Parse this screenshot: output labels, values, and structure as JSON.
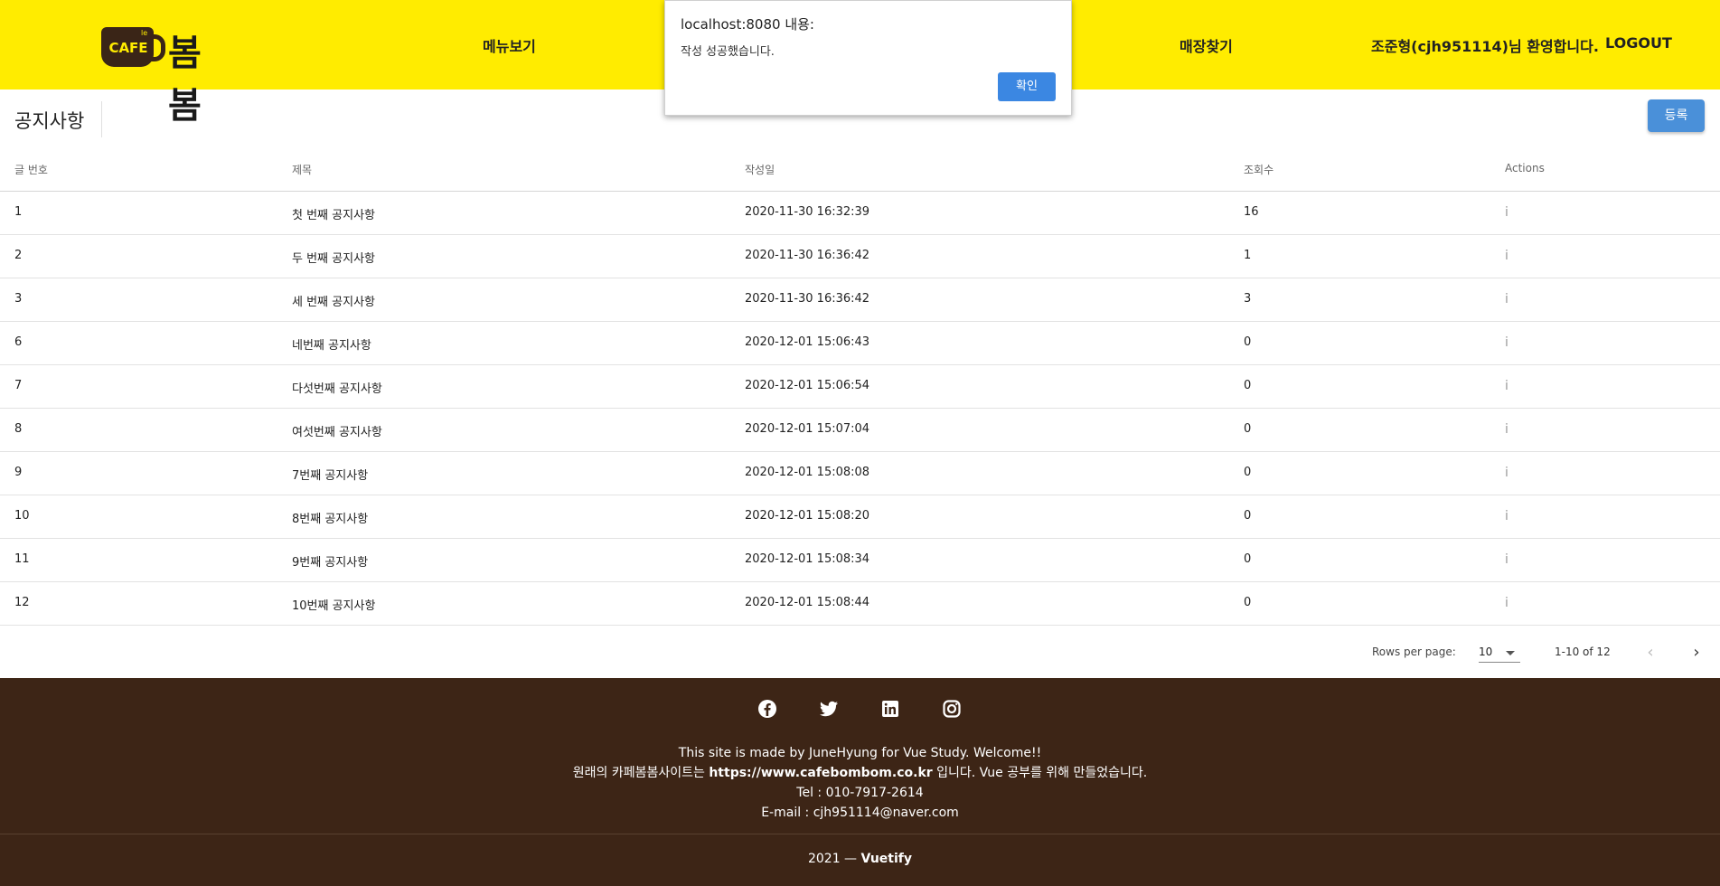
{
  "header": {
    "logo_cup_text": "CAFE",
    "logo_cup_small": "le",
    "logo_brand": "봄봄",
    "nav": {
      "menu": "메뉴보기",
      "store": "매장찾기"
    },
    "welcome": "조준형(cjh951114)님 환영합니다.",
    "logout": "LOGOUT"
  },
  "page": {
    "title": "공지사항",
    "register_label": "등록"
  },
  "table": {
    "headers": [
      "글 번호",
      "제목",
      "작성일",
      "조회수",
      "Actions"
    ],
    "rows": [
      {
        "no": "1",
        "title": "첫 번째 공지사항",
        "date": "2020-11-30 16:32:39",
        "views": "16"
      },
      {
        "no": "2",
        "title": "두 번째 공지사항",
        "date": "2020-11-30 16:36:42",
        "views": "1"
      },
      {
        "no": "3",
        "title": "세 번째 공지사항",
        "date": "2020-11-30 16:36:42",
        "views": "3"
      },
      {
        "no": "6",
        "title": "네번째 공지사항",
        "date": "2020-12-01 15:06:43",
        "views": "0"
      },
      {
        "no": "7",
        "title": "다섯번째 공지사항",
        "date": "2020-12-01 15:06:54",
        "views": "0"
      },
      {
        "no": "8",
        "title": "여섯번째 공지사항",
        "date": "2020-12-01 15:07:04",
        "views": "0"
      },
      {
        "no": "9",
        "title": "7번째 공지사항",
        "date": "2020-12-01 15:08:08",
        "views": "0"
      },
      {
        "no": "10",
        "title": "8번째 공지사항",
        "date": "2020-12-01 15:08:20",
        "views": "0"
      },
      {
        "no": "11",
        "title": "9번째 공지사항",
        "date": "2020-12-01 15:08:34",
        "views": "0"
      },
      {
        "no": "12",
        "title": "10번째 공지사항",
        "date": "2020-12-01 15:08:44",
        "views": "0"
      }
    ],
    "action_icon": "i"
  },
  "pagination": {
    "rows_per_page_label": "Rows per page:",
    "rows_per_page_value": "10",
    "range": "1-10 of 12",
    "prev_icon": "‹",
    "next_icon": "›"
  },
  "footer": {
    "icons": [
      "facebook-icon",
      "twitter-icon",
      "linkedin-icon",
      "instagram-icon"
    ],
    "line1": "This site is made by JuneHyung for Vue Study. Welcome!!",
    "line2_pre": "원래의 카페봄봄사이트는 ",
    "line2_url": "https://www.cafebombom.co.kr",
    "line2_post": " 입니다. Vue 공부를 위해 만들었습니다.",
    "line3": "Tel : 010-7917-2614",
    "line4": "E-mail : cjh951114@naver.com",
    "copyright_year": "2021 — ",
    "copyright_brand": "Vuetify"
  },
  "alert": {
    "title": "localhost:8080 내용:",
    "message": "작성 성공했습니다.",
    "ok_label": "확인"
  },
  "colors": {
    "header_bg": "#ffec00",
    "footer_bg": "#3d2516",
    "primary_button": "#4a90d9",
    "alert_button": "#3b87e2"
  }
}
